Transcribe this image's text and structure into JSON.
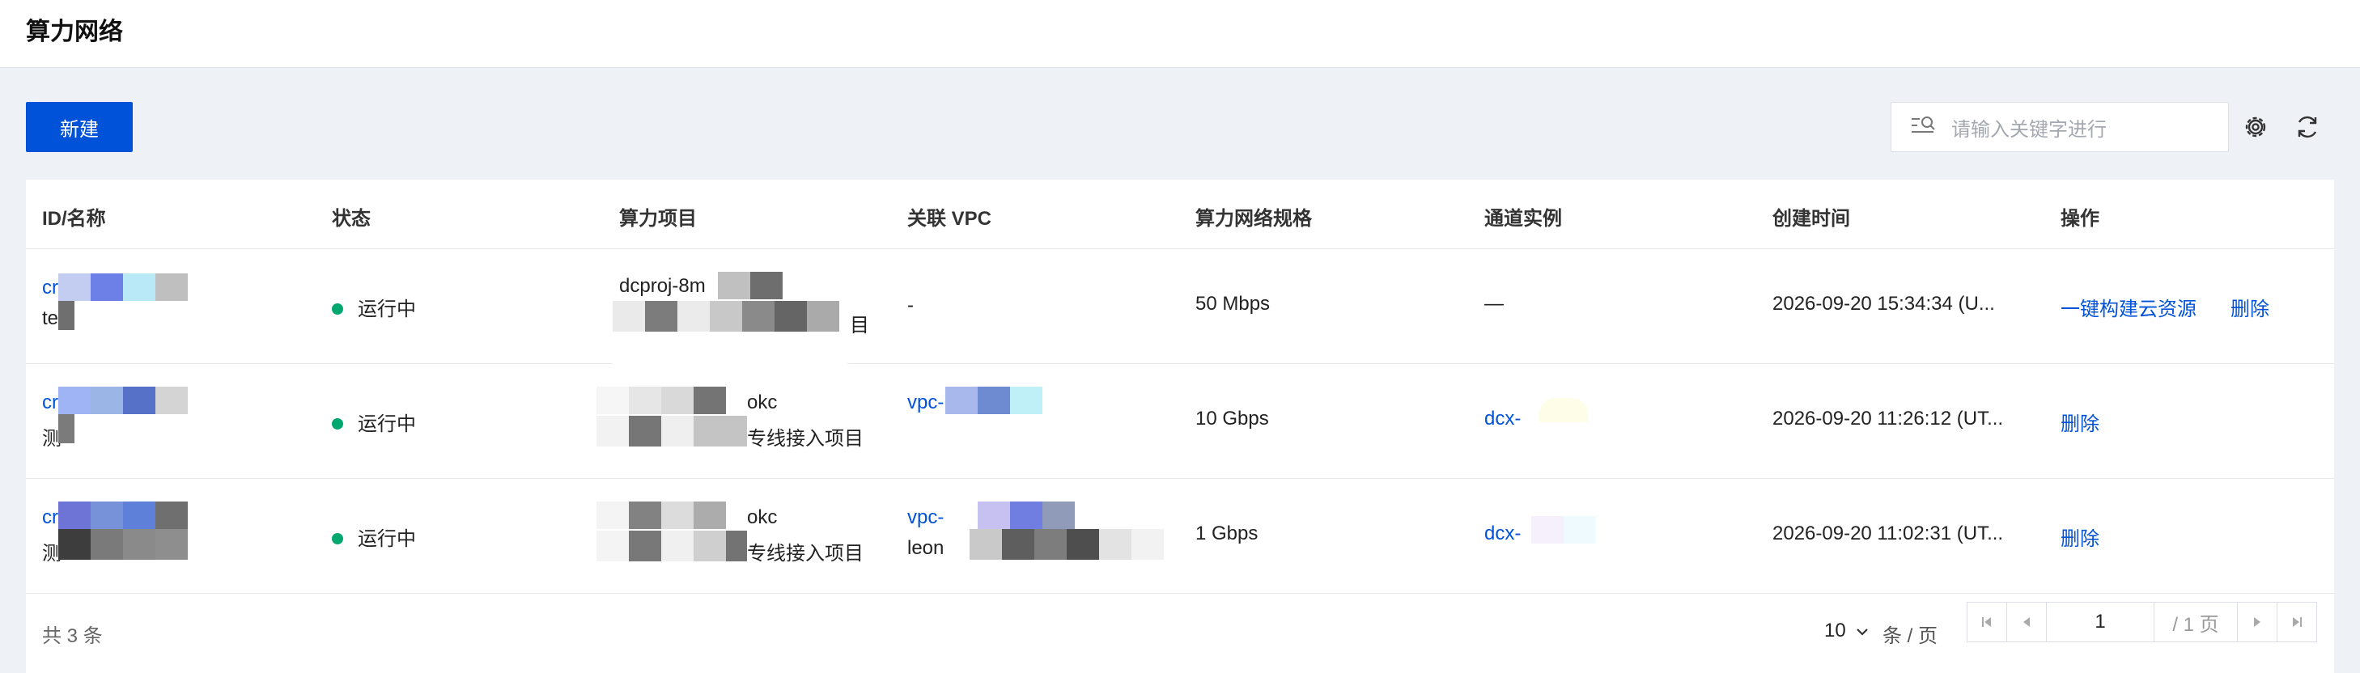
{
  "page": {
    "title": "算力网络"
  },
  "toolbar": {
    "new_label": "新建",
    "search_placeholder": "请输入关键字进行",
    "settings_icon": "gear-icon",
    "refresh_icon": "refresh-icon"
  },
  "table": {
    "headers": [
      "ID/名称",
      "状态",
      "算力项目",
      "关联 VPC",
      "算力网络规格",
      "通道实例",
      "创建时间",
      "操作"
    ],
    "rows": [
      {
        "id_prefix": "cr",
        "name_prefix": "te",
        "status": "运行中",
        "project_line1": "dcproj-8m",
        "project_line2": "目",
        "vpc_line1": "-",
        "vpc_line2": "",
        "spec": "50 Mbps",
        "channel": "—",
        "created": "2026-09-20 15:34:34 (U...",
        "actions": [
          "一键构建云资源",
          "删除"
        ]
      },
      {
        "id_prefix": "cr",
        "name_prefix": "测",
        "status": "运行中",
        "project_line1": "okc",
        "project_line2": "专线接入项目",
        "vpc_line1": "vpc-",
        "vpc_line2": "",
        "spec": "10 Gbps",
        "channel": "dcx-",
        "created": "2026-09-20 11:26:12 (UT...",
        "actions": [
          "删除"
        ]
      },
      {
        "id_prefix": "cr",
        "name_prefix": "测",
        "status": "运行中",
        "project_line1": "okc",
        "project_line2": "专线接入项目",
        "vpc_line1": "vpc-",
        "vpc_line2": "leon",
        "spec": "1 Gbps",
        "channel": "dcx-",
        "created": "2026-09-20 11:02:31 (UT...",
        "actions": [
          "删除"
        ]
      }
    ]
  },
  "footer": {
    "total": "共 3 条",
    "page_size": "10",
    "page_size_unit": "条 / 页",
    "current_page": "1",
    "total_pages": "/ 1 页"
  },
  "colors": {
    "primary": "#0052d9",
    "status_running": "#00a870"
  }
}
